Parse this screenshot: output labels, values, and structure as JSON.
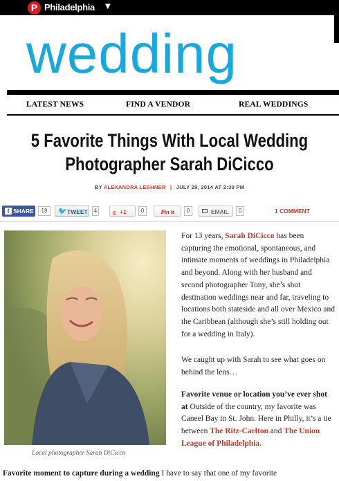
{
  "brand": {
    "logo_letter": "P",
    "name": "Philadelphia",
    "caret": "▼"
  },
  "masthead": "wedding",
  "nav": [
    "LATEST NEWS",
    "FIND A VENDOR",
    "REAL WEDDINGS"
  ],
  "article": {
    "headline_line1": "5 Favorite Things With Local Wedding",
    "headline_line2": "Photographer Sarah DiCicco",
    "byline_prefix": "BY",
    "author": "ALEXANDRA LESHNER",
    "separator": "|",
    "date": "JULY 29, 2014 AT 2:30 PM"
  },
  "share": {
    "facebook": {
      "label": "SHARE",
      "count": "19"
    },
    "twitter": {
      "label": "TWEET",
      "count": "4"
    },
    "google": {
      "label": "+1",
      "count": "0"
    },
    "pinterest": {
      "label": "Pin it",
      "count": "0"
    },
    "email": {
      "label": "EMAIL",
      "count": "0"
    },
    "comments": "1 COMMENT"
  },
  "photo_caption": "Local photographer Sarah DiCicco",
  "body": {
    "p1_pre": "For 13 years, ",
    "p1_name": "Sarah DiCicco",
    "p1_post": " has been capturing the emotional, spontaneous, and intimate moments of weddings in Philadelphia and beyond. Along with her husband and second photographer Tony, she’s shot destination weddings near and far, traveling to locations both stateside and all over Mexico and the Caribbean (although she’s still holding out for a wedding in Italy).",
    "p2": "We caught up with Sarah to see what goes on behind the lens…",
    "p3_q": "Favorite venue or location you’ve ever shot at",
    "p3_a": " Outside of the country, my favorite was Caneel Bay in St. John. Here in Philly, it’s a tie between ",
    "p3_link1": "The Ritz-Carlton",
    "p3_and": " and ",
    "p3_link2": "The Union League of Philadelphia",
    "p3_end": ".",
    "p4_q": "Favorite moment to capture during a wedding",
    "p4_a": " I have to say that one of my favorite"
  },
  "colors": {
    "accent_blue": "#18a8de",
    "link_red": "#c0392b",
    "brand_red": "#d81f26"
  }
}
